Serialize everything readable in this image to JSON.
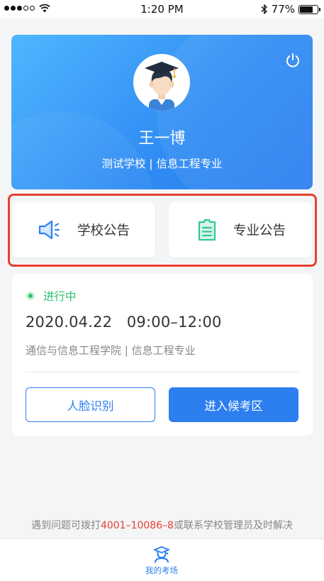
{
  "status_bar": {
    "time": "1:20 PM",
    "battery": "77%",
    "battery_level": 0.77
  },
  "profile": {
    "name": "王一博",
    "school": "测试学校 | 信息工程专业",
    "icons": {
      "power": "power-icon",
      "avatar": "graduate-avatar"
    }
  },
  "announcements": [
    {
      "label": "学校公告",
      "icon": "megaphone-icon"
    },
    {
      "label": "专业公告",
      "icon": "document-icon"
    }
  ],
  "exam": {
    "status": "进行中",
    "datetime": "2020.04.22   09:00–12:00",
    "department": "通信与信息工程学院 | 信息工程专业",
    "face_button": "人脸识别",
    "enter_button": "进入候考区"
  },
  "footer": {
    "prefix": "遇到问题可拨打",
    "phone": "4001–10086–8",
    "suffix": "或联系学校管理员及时解决"
  },
  "tabbar": {
    "tab_label": "我的考场",
    "tab_icon": "exam-hall-icon"
  },
  "colors": {
    "primary": "#2d7ff0",
    "highlight": "#e8402f",
    "status_green": "#2fbf6d",
    "doc_icon": "#34c59a"
  }
}
